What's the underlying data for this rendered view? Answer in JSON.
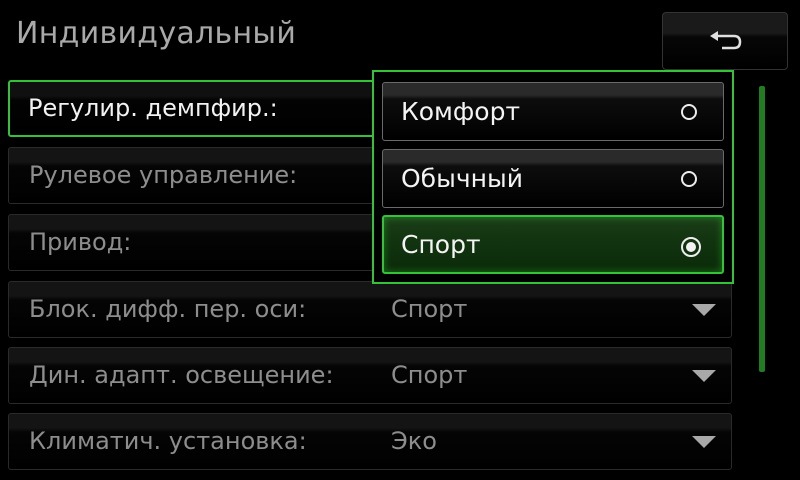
{
  "header": {
    "title": "Индивидуальный",
    "back_icon": "back-arrow-icon"
  },
  "settings": [
    {
      "label": "Регулир. демпфир.:",
      "value": "",
      "active": true
    },
    {
      "label": "Рулевое управление:",
      "value": ""
    },
    {
      "label": "Привод:",
      "value": ""
    },
    {
      "label": "Блок. дифф. пер. оси:",
      "value": "Спорт"
    },
    {
      "label": "Дин. адапт. освещение:",
      "value": "Спорт"
    },
    {
      "label": "Климатич. установка:",
      "value": "Эко"
    }
  ],
  "popup": {
    "options": [
      {
        "label": "Комфорт",
        "selected": false
      },
      {
        "label": "Обычный",
        "selected": false
      },
      {
        "label": "Спорт",
        "selected": true
      }
    ]
  },
  "colors": {
    "accent_green": "#33c238",
    "text_primary": "#f2f2f2",
    "text_dimmed": "#8d8d8d",
    "background": "#000000"
  }
}
